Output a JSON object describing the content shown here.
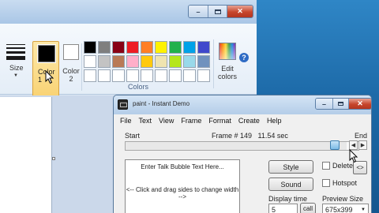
{
  "paint": {
    "ribbon": {
      "size_label": "Size",
      "color1_label": "Color\n1",
      "color1_value": "#000000",
      "color2_label": "Color\n2",
      "color2_value": "#ffffff",
      "colors_group_label": "Colors",
      "edit_colors_label": "Edit\ncolors",
      "palette": [
        "#000000",
        "#7f7f7f",
        "#880015",
        "#ed1c24",
        "#ff7f27",
        "#fff200",
        "#22b14c",
        "#00a2e8",
        "#3f48cc",
        "#ffffff",
        "#c3c3c3",
        "#b97a57",
        "#ffaec9",
        "#ffc90e",
        "#efe4b0",
        "#b5e61d",
        "#99d9ea",
        "#7092be",
        "#ffffff",
        "#ffffff",
        "#ffffff",
        "#ffffff",
        "#ffffff",
        "#ffffff",
        "#ffffff",
        "#ffffff",
        "#ffffff"
      ]
    }
  },
  "demo": {
    "title": "paint - Instant Demo",
    "menu": [
      "File",
      "Text",
      "View",
      "Frame",
      "Format",
      "Create",
      "Help"
    ],
    "timeline": {
      "start_label": "Start",
      "end_label": "End",
      "frame_info": "Frame # 149   11.54 sec",
      "position_fraction": 0.95
    },
    "bubble_text": {
      "prompt": "Enter Talk Bubble Text Here...",
      "hint": "<-- Click and drag sides to change width -->"
    },
    "buttons": {
      "style": "Style",
      "sound": "Sound",
      "call": "call",
      "swap": "<>"
    },
    "checkboxes": {
      "delete": "Delete",
      "hotspot": "Hotspot"
    },
    "display_time": {
      "label": "Display time",
      "value": "5"
    },
    "preview_size": {
      "label": "Preview Size",
      "value": "675x399"
    }
  }
}
